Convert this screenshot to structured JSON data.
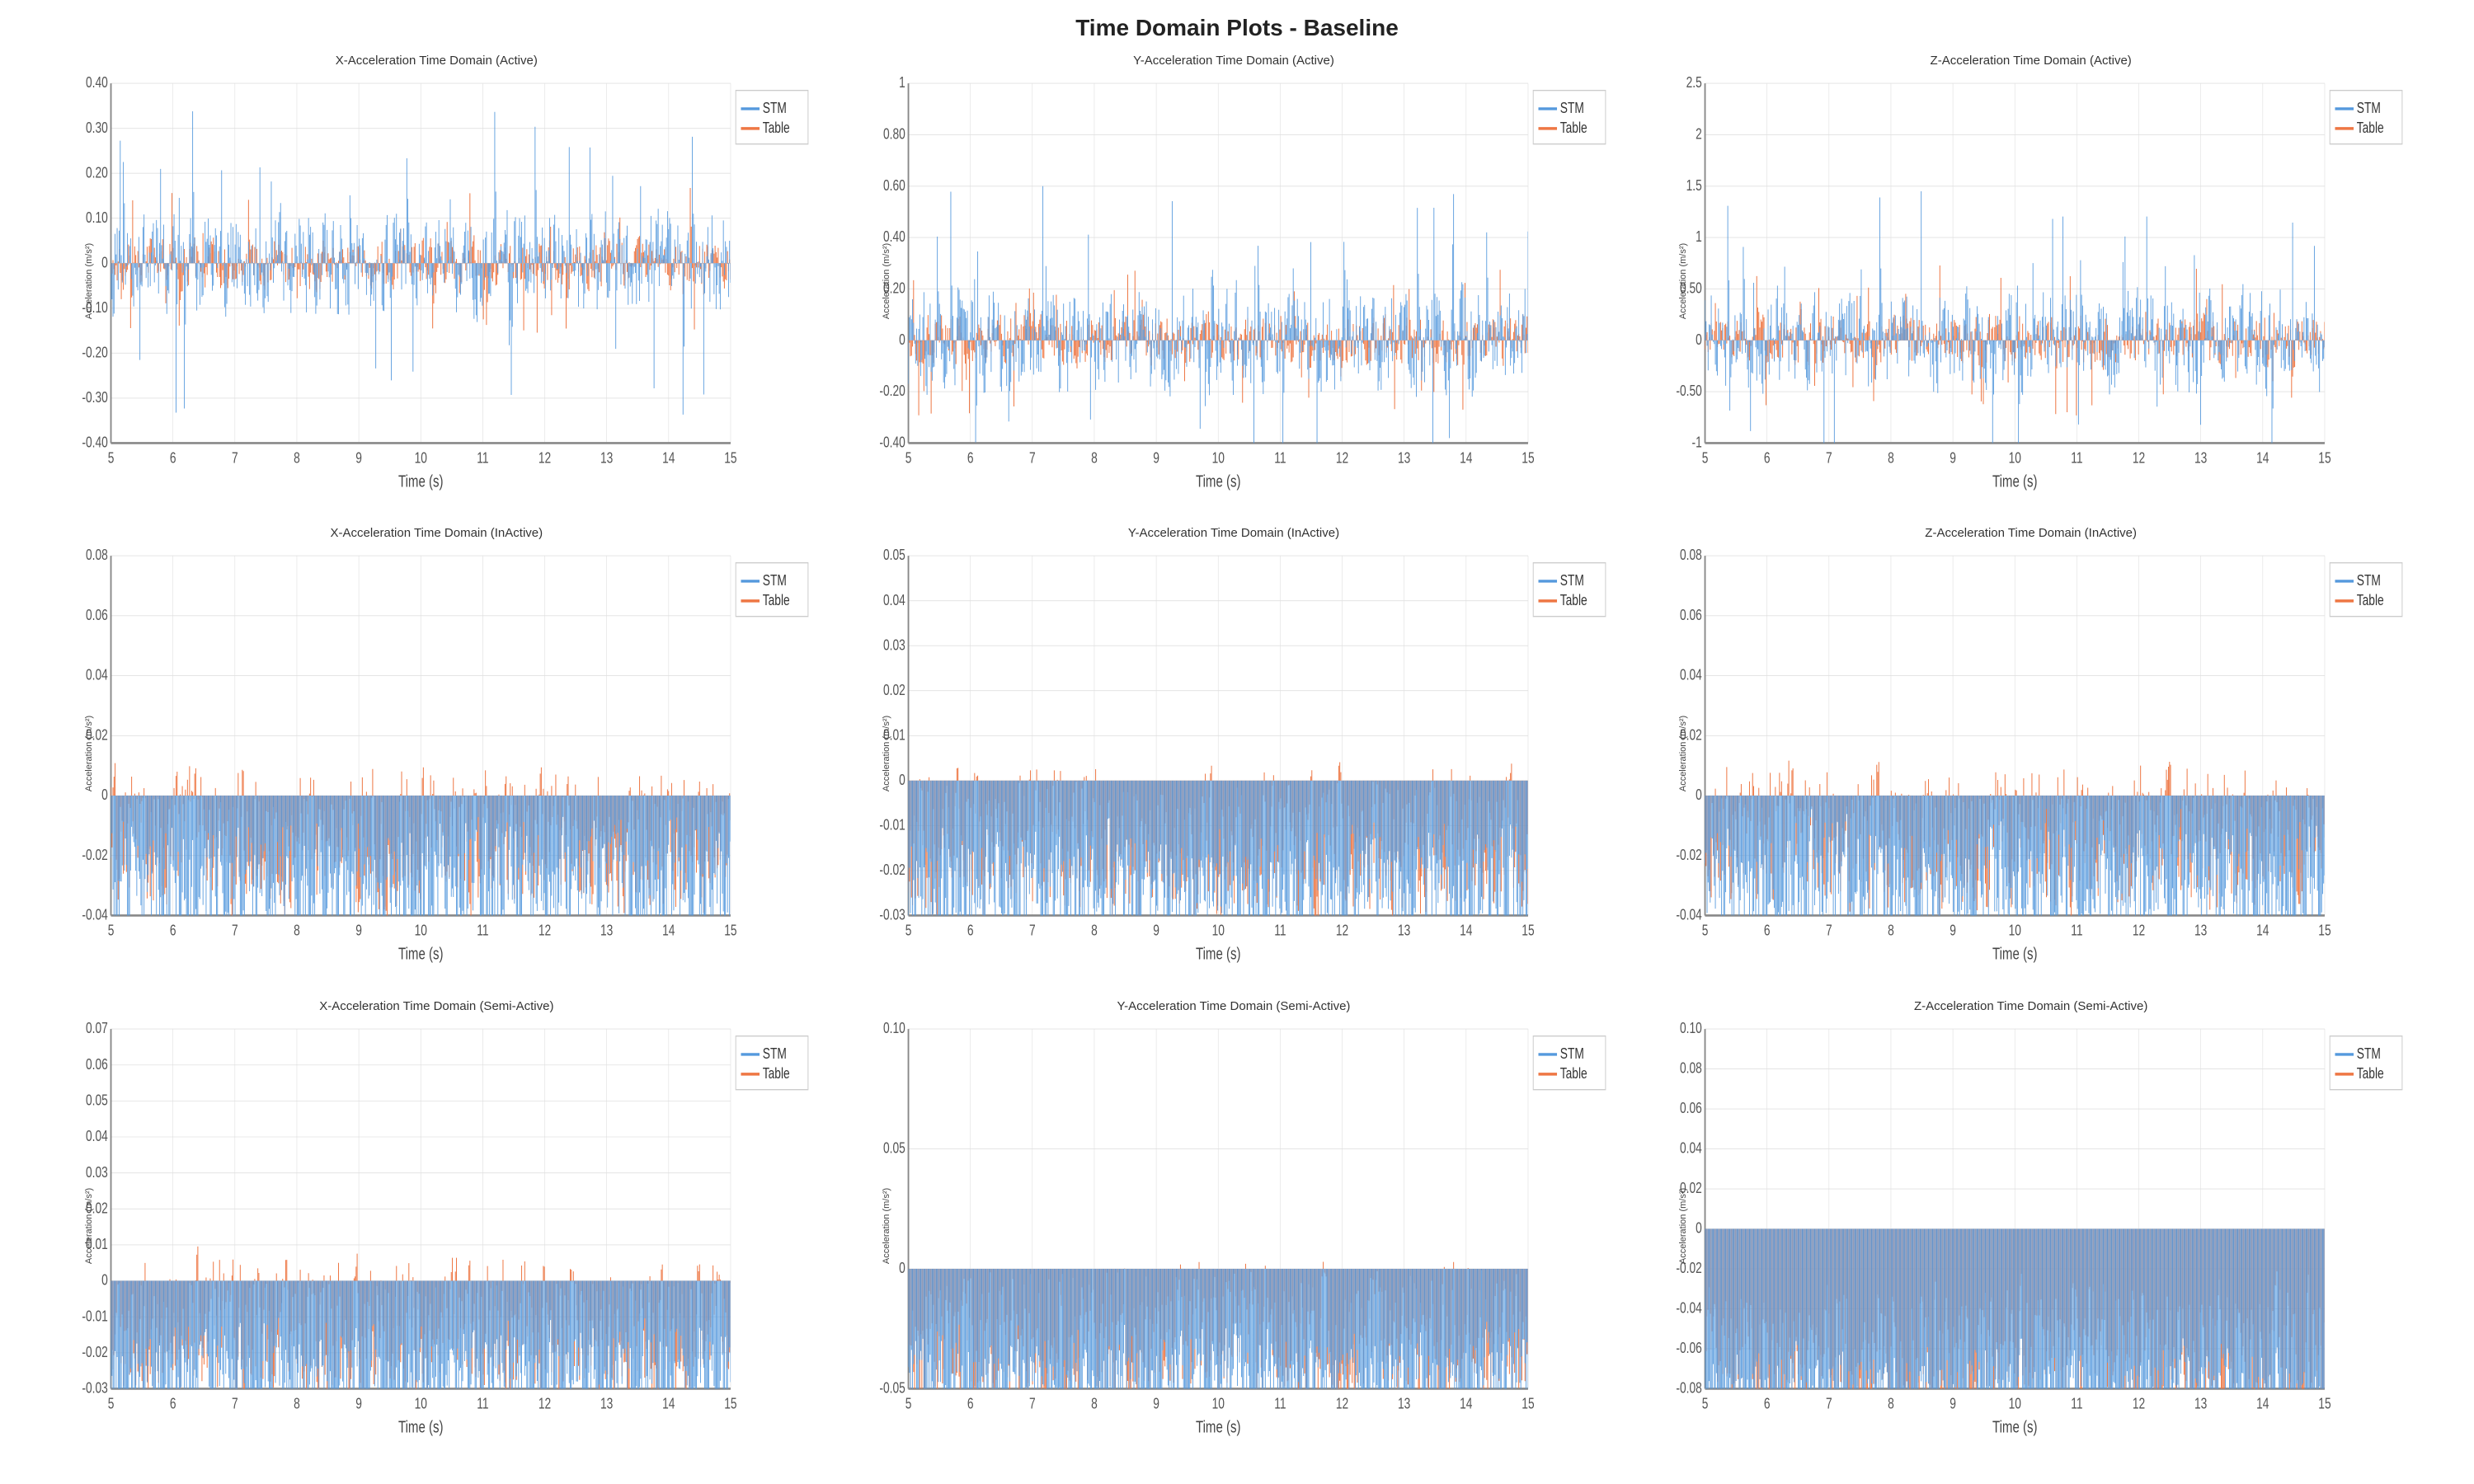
{
  "page": {
    "title": "Time Domain Plots - Baseline",
    "background": "#ffffff"
  },
  "legend": {
    "stm_label": "STM",
    "stm_color": "#5599dd",
    "table_label": "Table",
    "table_color": "#ee7744"
  },
  "charts": [
    {
      "id": "chart-x-active",
      "title": "X-Acceleration Time Domain (Active)",
      "y_label": "Acceleration (m/s²)",
      "x_label": "Time (s)",
      "y_min": -0.4,
      "y_max": 0.4,
      "y_ticks": [
        -0.4,
        -0.3,
        -0.2,
        -0.1,
        0,
        0.1,
        0.2,
        0.3,
        0.4
      ],
      "x_min": 5,
      "x_max": 15,
      "x_ticks": [
        5,
        6,
        7,
        8,
        9,
        10,
        11,
        12,
        13,
        14,
        15
      ]
    },
    {
      "id": "chart-y-active",
      "title": "Y-Acceleration Time Domain (Active)",
      "y_label": "Acceleration (m/s²)",
      "x_label": "Time (s)",
      "y_min": -0.4,
      "y_max": 1.0,
      "y_ticks": [
        -0.4,
        -0.2,
        0,
        0.2,
        0.4,
        0.6,
        0.8,
        1.0
      ],
      "x_min": 5,
      "x_max": 15,
      "x_ticks": [
        5,
        6,
        7,
        8,
        9,
        10,
        11,
        12,
        13,
        14,
        15
      ]
    },
    {
      "id": "chart-z-active",
      "title": "Z-Acceleration Time Domain (Active)",
      "y_label": "Acceleration (m/s²)",
      "x_label": "Time (s)",
      "y_min": -1.0,
      "y_max": 2.5,
      "y_ticks": [
        -1.0,
        -0.5,
        0,
        0.5,
        1.0,
        1.5,
        2.0,
        2.5
      ],
      "x_min": 5,
      "x_max": 15,
      "x_ticks": [
        5,
        6,
        7,
        8,
        9,
        10,
        11,
        12,
        13,
        14,
        15
      ]
    },
    {
      "id": "chart-x-inactive",
      "title": "X-Acceleration Time Domain (InActive)",
      "y_label": "Acceleration (m/s²)",
      "x_label": "Time (s)",
      "y_min": -0.04,
      "y_max": 0.08,
      "y_ticks": [
        -0.04,
        -0.02,
        0,
        0.02,
        0.04,
        0.06,
        0.08
      ],
      "x_min": 5,
      "x_max": 15,
      "x_ticks": [
        5,
        6,
        7,
        8,
        9,
        10,
        11,
        12,
        13,
        14,
        15
      ]
    },
    {
      "id": "chart-y-inactive",
      "title": "Y-Acceleration Time Domain (InActive)",
      "y_label": "Acceleration (m/s²)",
      "x_label": "Time (s)",
      "y_min": -0.03,
      "y_max": 0.05,
      "y_ticks": [
        -0.03,
        -0.02,
        -0.01,
        0,
        0.01,
        0.02,
        0.03,
        0.04,
        0.05
      ],
      "x_min": 5,
      "x_max": 15,
      "x_ticks": [
        5,
        6,
        7,
        8,
        9,
        10,
        11,
        12,
        13,
        14,
        15
      ]
    },
    {
      "id": "chart-z-inactive",
      "title": "Z-Acceleration Time Domain (InActive)",
      "y_label": "Acceleration (m/s²)",
      "x_label": "Time (s)",
      "y_min": -0.04,
      "y_max": 0.08,
      "y_ticks": [
        -0.04,
        -0.02,
        0,
        0.02,
        0.04,
        0.06,
        0.08
      ],
      "x_min": 5,
      "x_max": 15,
      "x_ticks": [
        5,
        6,
        7,
        8,
        9,
        10,
        11,
        12,
        13,
        14,
        15
      ]
    },
    {
      "id": "chart-x-semiactive",
      "title": "X-Acceleration Time Domain (Semi-Active)",
      "y_label": "Acceleration (m/s²)",
      "x_label": "Time (s)",
      "y_min": -0.03,
      "y_max": 0.07,
      "y_ticks": [
        -0.03,
        -0.02,
        -0.01,
        0,
        0.01,
        0.02,
        0.03,
        0.04,
        0.05,
        0.06,
        0.07
      ],
      "x_min": 5,
      "x_max": 15,
      "x_ticks": [
        5,
        6,
        7,
        8,
        9,
        10,
        11,
        12,
        13,
        14,
        15
      ]
    },
    {
      "id": "chart-y-semiactive",
      "title": "Y-Acceleration Time Domain (Semi-Active)",
      "y_label": "Acceleration (m/s²)",
      "x_label": "Time (s)",
      "y_min": -0.05,
      "y_max": 0.1,
      "y_ticks": [
        -0.05,
        0,
        0.05,
        0.1
      ],
      "x_min": 5,
      "x_max": 15,
      "x_ticks": [
        5,
        6,
        7,
        8,
        9,
        10,
        11,
        12,
        13,
        14,
        15
      ]
    },
    {
      "id": "chart-z-semiactive",
      "title": "Z-Acceleration Time Domain (Semi-Active)",
      "y_label": "Acceleration (m/s²)",
      "x_label": "Time (s)",
      "y_min": -0.08,
      "y_max": 0.1,
      "y_ticks": [
        -0.08,
        -0.06,
        -0.04,
        -0.02,
        0,
        0.02,
        0.04,
        0.06,
        0.08,
        0.1
      ],
      "x_min": 5,
      "x_max": 15,
      "x_ticks": [
        5,
        6,
        7,
        8,
        9,
        10,
        11,
        12,
        13,
        14,
        15
      ]
    }
  ]
}
